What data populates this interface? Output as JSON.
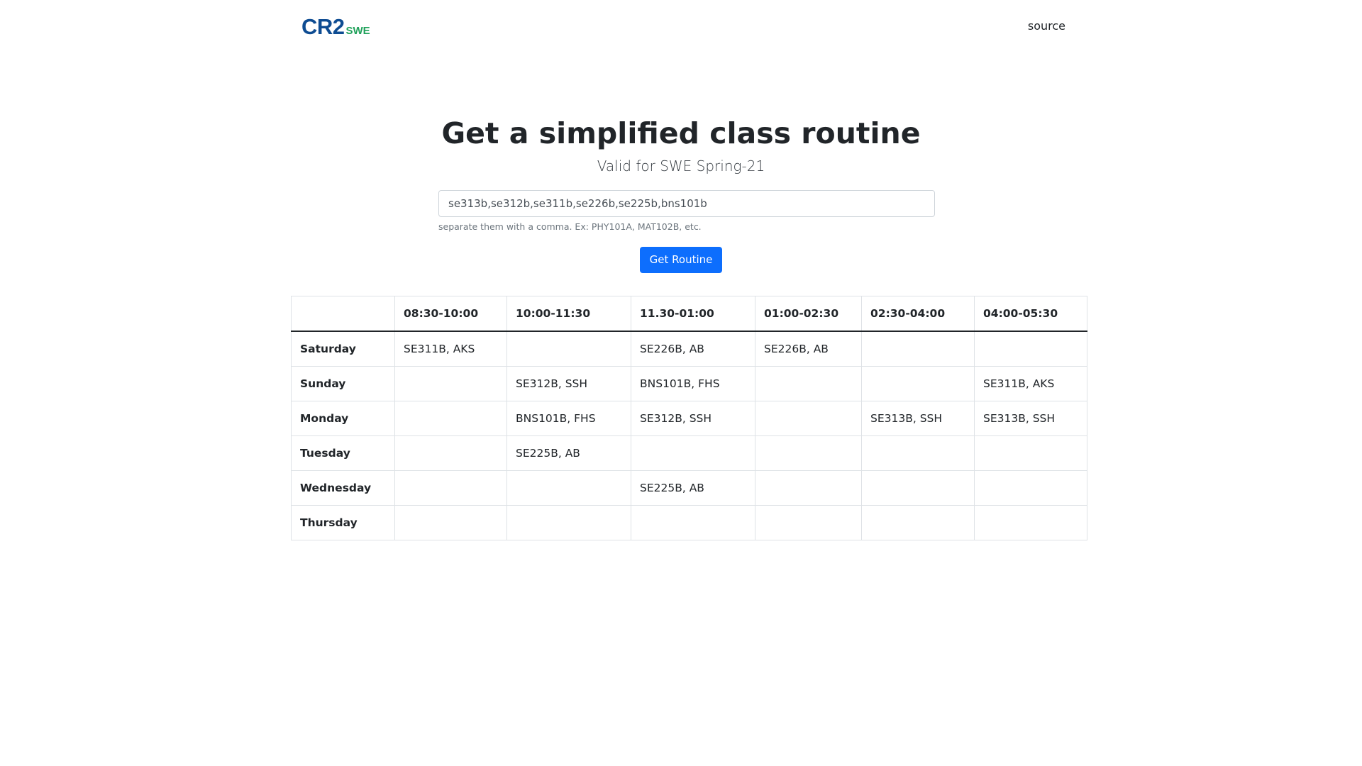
{
  "nav": {
    "brand_main": "CR2",
    "brand_sub": "SWE",
    "source_link": "source"
  },
  "hero": {
    "title": "Get a simplified class routine",
    "subtitle": "Valid for SWE Spring-21"
  },
  "form": {
    "course_input_value": "se313b,se312b,se311b,se226b,se225b,bns101b",
    "help_text": "separate them with a comma. Ex: PHY101A, MAT102B, etc.",
    "submit_label": "Get Routine"
  },
  "routine": {
    "corner": "",
    "time_slots": [
      "08:30-10:00",
      "10:00-11:30",
      "11.30-01:00",
      "01:00-02:30",
      "02:30-04:00",
      "04:00-05:30"
    ],
    "rows": [
      {
        "day": "Saturday",
        "cells": [
          "SE311B, AKS",
          "",
          "SE226B, AB",
          "SE226B, AB",
          "",
          ""
        ]
      },
      {
        "day": "Sunday",
        "cells": [
          "",
          "SE312B, SSH",
          "BNS101B, FHS",
          "",
          "",
          "SE311B, AKS"
        ]
      },
      {
        "day": "Monday",
        "cells": [
          "",
          "BNS101B, FHS",
          "SE312B, SSH",
          "",
          "SE313B, SSH",
          "SE313B, SSH"
        ]
      },
      {
        "day": "Tuesday",
        "cells": [
          "",
          "SE225B, AB",
          "",
          "",
          "",
          ""
        ]
      },
      {
        "day": "Wednesday",
        "cells": [
          "",
          "",
          "SE225B, AB",
          "",
          "",
          ""
        ]
      },
      {
        "day": "Thursday",
        "cells": [
          "",
          "",
          "",
          "",
          "",
          ""
        ]
      }
    ]
  },
  "colors": {
    "brand_main": "#0e4c92",
    "brand_sub": "#1fa15a",
    "primary_button": "#0d6efd"
  }
}
